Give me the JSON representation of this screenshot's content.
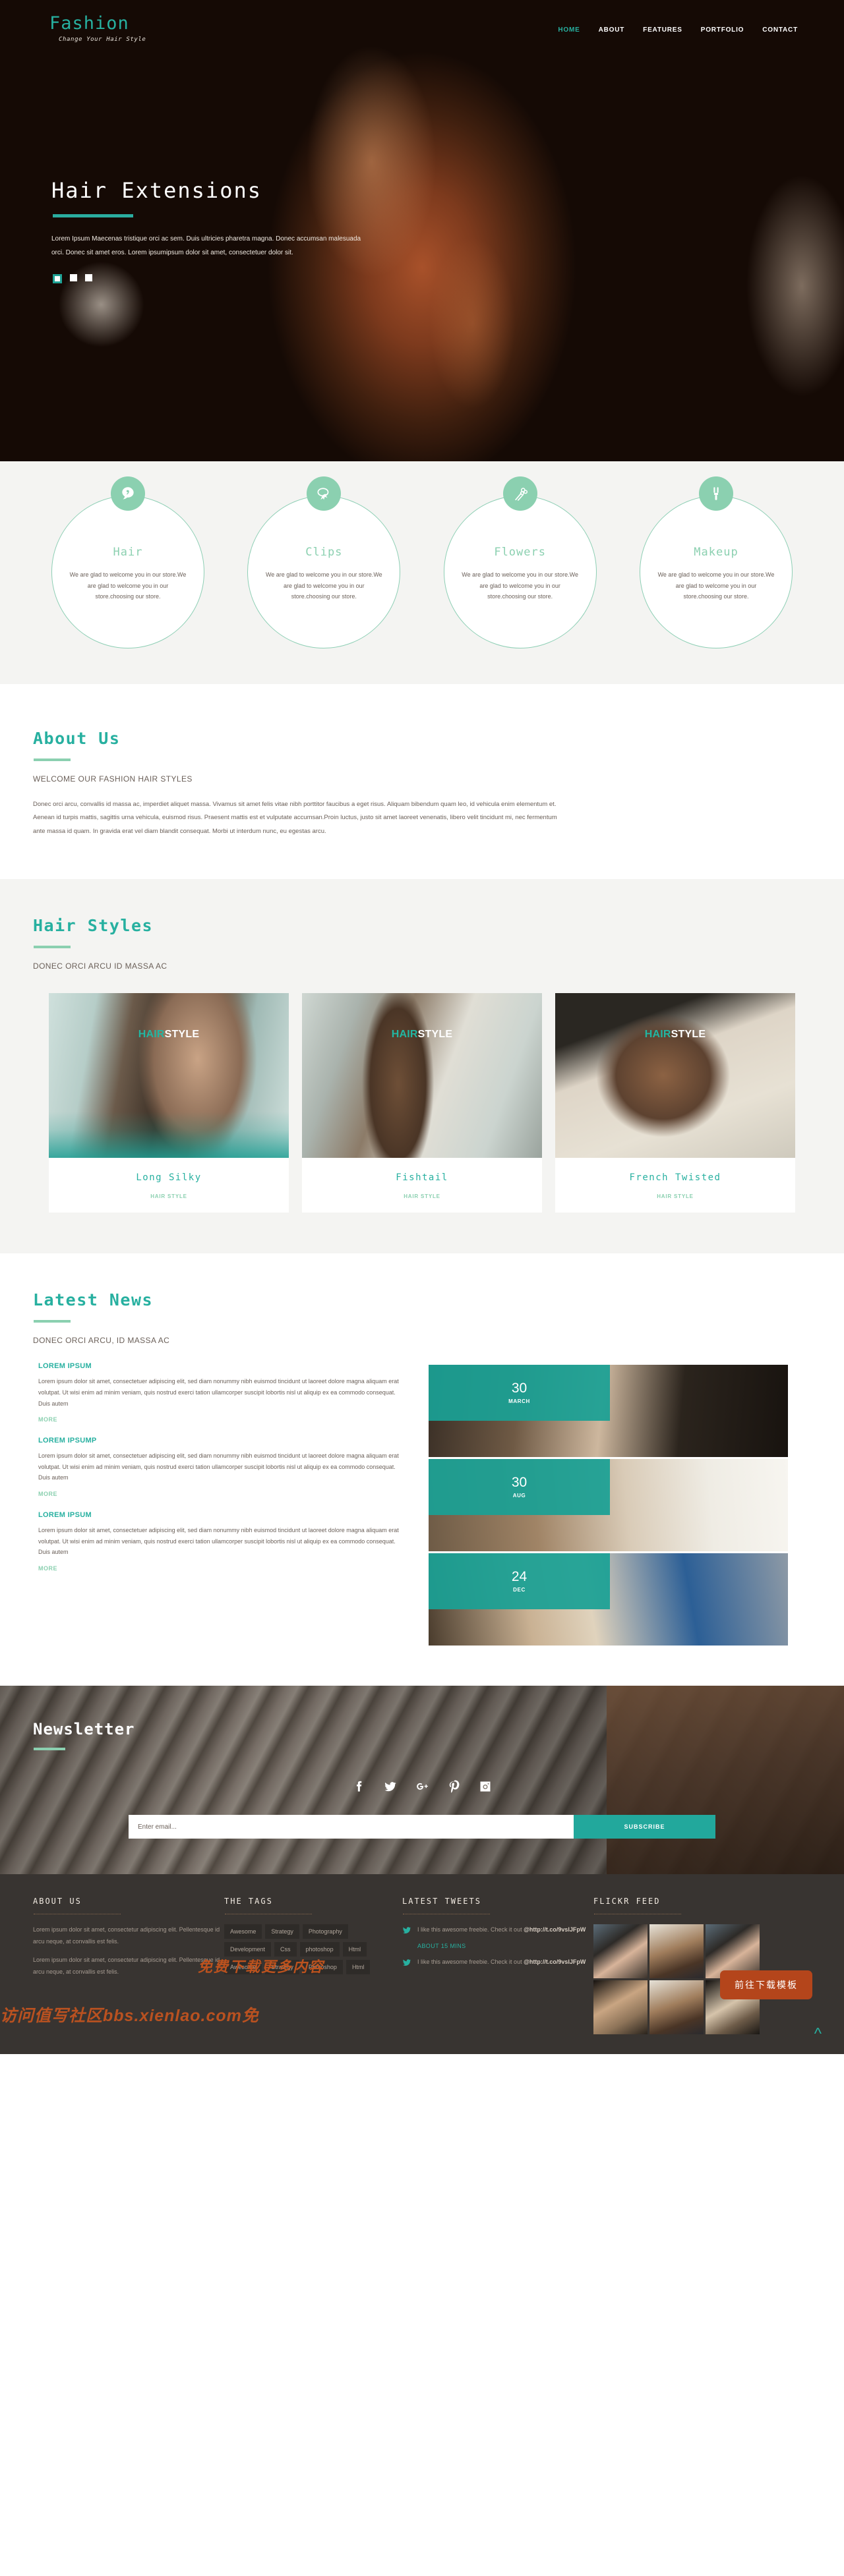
{
  "brand": {
    "name": "Fashion",
    "tagline": "Change Your Hair Style"
  },
  "nav": [
    {
      "label": "HOME",
      "active": true
    },
    {
      "label": "ABOUT",
      "active": false
    },
    {
      "label": "FEATURES",
      "active": false
    },
    {
      "label": "PORTFOLIO",
      "active": false
    },
    {
      "label": "CONTACT",
      "active": false
    }
  ],
  "hero": {
    "title": "Hair Extensions",
    "text": "Lorem Ipsum Maecenas tristique orci ac sem. Duis ultricies pharetra magna. Donec accumsan malesuada orci. Donec sit amet eros. Lorem ipsumipsum dolor sit amet, consectetuer dolor sit.",
    "slides": 3,
    "active_slide": 1
  },
  "services": [
    {
      "icon": "comma-quote-icon",
      "title": "Hair",
      "text": "We are glad to welcome you in our store.We are glad to welcome you in our store.choosing our store."
    },
    {
      "icon": "hair-clip-icon",
      "title": "Clips",
      "text": "We are glad to welcome you in our store.We are glad to welcome you in our store.choosing our store."
    },
    {
      "icon": "flower-pin-icon",
      "title": "Flowers",
      "text": "We are glad to welcome you in our store.We are glad to welcome you in our store.choosing our store."
    },
    {
      "icon": "makeup-brush-icon",
      "title": "Makeup",
      "text": "We are glad to welcome you in our store.We are glad to welcome you in our store.choosing our store."
    }
  ],
  "about": {
    "title": "About Us",
    "subtitle": "WELCOME OUR FASHION HAIR STYLES",
    "body": "Donec orci arcu, convallis id massa ac, imperdiet aliquet massa. Vivamus sit amet felis vitae nibh porttitor faucibus a eget risus. Aliquam bibendum quam leo, id vehicula enim elementum et. Aenean id turpis mattis, sagittis urna vehicula, euismod risus. Praesent mattis est et vulputate accumsan.Proin luctus, justo sit amet laoreet venenatis, libero velit tincidunt mi, nec fermentum ante massa id quam. In gravida erat vel diam blandit consequat. Morbi ut interdum nunc, eu egestas arcu."
  },
  "styles": {
    "title": "Hair Styles",
    "subtitle": "DONEC ORCI ARCU ID MASSA AC",
    "overlay_a": "HAIR",
    "overlay_b": "STYLE",
    "cards": [
      {
        "name": "Long Silky",
        "category": "HAIR STYLE"
      },
      {
        "name": "Fishtail",
        "category": "HAIR STYLE"
      },
      {
        "name": "French Twisted",
        "category": "HAIR STYLE"
      }
    ]
  },
  "news": {
    "title": "Latest News",
    "subtitle": "DONEC ORCI ARCU, ID MASSA AC",
    "posts": [
      {
        "title": "LOREM IPSUM",
        "body": "Lorem ipsum dolor sit amet, consectetuer adipiscing elit, sed diam nonummy nibh euismod tincidunt ut laoreet dolore magna aliquam erat volutpat. Ut wisi enim ad minim veniam, quis nostrud exerci tation ullamcorper suscipit lobortis nisl ut aliquip ex ea commodo consequat. Duis autem",
        "more": "MORE"
      },
      {
        "title": "LOREM IPSUMP",
        "body": "Lorem ipsum dolor sit amet, consectetuer adipiscing elit, sed diam nonummy nibh euismod tincidunt ut laoreet dolore magna aliquam erat volutpat. Ut wisi enim ad minim veniam, quis nostrud exerci tation ullamcorper suscipit lobortis nisl ut aliquip ex ea commodo consequat. Duis autem",
        "more": "MORE"
      },
      {
        "title": "LOREM IPSUM",
        "body": "Lorem ipsum dolor sit amet, consectetuer adipiscing elit, sed diam nonummy nibh euismod tincidunt ut laoreet dolore magna aliquam erat volutpat. Ut wisi enim ad minim veniam, quis nostrud exerci tation ullamcorper suscipit lobortis nisl ut aliquip ex ea commodo consequat. Duis autem",
        "more": "MORE"
      }
    ],
    "items": [
      {
        "day": "30",
        "month": "MARCH"
      },
      {
        "day": "30",
        "month": "AUG"
      },
      {
        "day": "24",
        "month": "DEC"
      }
    ]
  },
  "newsletter": {
    "title": "Newsletter",
    "socials": [
      {
        "icon": "facebook-icon",
        "label": "Facebook"
      },
      {
        "icon": "twitter-icon",
        "label": "Twitter"
      },
      {
        "icon": "google-plus-icon",
        "label": "Google Plus"
      },
      {
        "icon": "pinterest-icon",
        "label": "Pinterest"
      },
      {
        "icon": "instagram-icon",
        "label": "Instagram"
      }
    ],
    "email_placeholder": "Enter email...",
    "email_value": "",
    "subscribe_label": "SUBSCRIBE"
  },
  "footer": {
    "about": {
      "title": "ABOUT US",
      "p1": "Lorem ipsum dolor sit amet, consectetur adipiscing elit. Pellentesque id arcu neque, at convallis est felis.",
      "p2": "Lorem ipsum dolor sit amet, consectetur adipiscing elit. Pellentesque id arcu neque, at convallis est felis."
    },
    "tags": {
      "title": "THE TAGS",
      "items": [
        "Awesome",
        "Strategy",
        "Photography",
        "Development",
        "Css",
        "photoshop",
        "Html",
        "Awesome",
        "Strategy",
        "Photoshop",
        "Html"
      ]
    },
    "tweets": {
      "title": "LATEST TWEETS",
      "items": [
        {
          "icon": "twitter-icon",
          "text": "I like this awesome freebie. Check it out ",
          "handle": "@http://t.co/9vslJFpW",
          "time": "ABOUT 15 MINS"
        },
        {
          "icon": "twitter-icon",
          "text": "I like this awesome freebie. Check it out ",
          "handle": "@http://t.co/9vslJFpW",
          "time": ""
        }
      ]
    },
    "flickr": {
      "title": "FLICKR FEED",
      "count": 6
    },
    "download_button": "前往下载模板",
    "to_top_icon": "chevron-up-icon",
    "watermark": "访问值写社区bbs.xienlao.com免",
    "watermark2": "免费下载更多内容"
  },
  "colors": {
    "accent": "#27b0a0",
    "accent_light": "#8bd0b0",
    "dark": "#383431",
    "body_text": "#6b6059"
  }
}
